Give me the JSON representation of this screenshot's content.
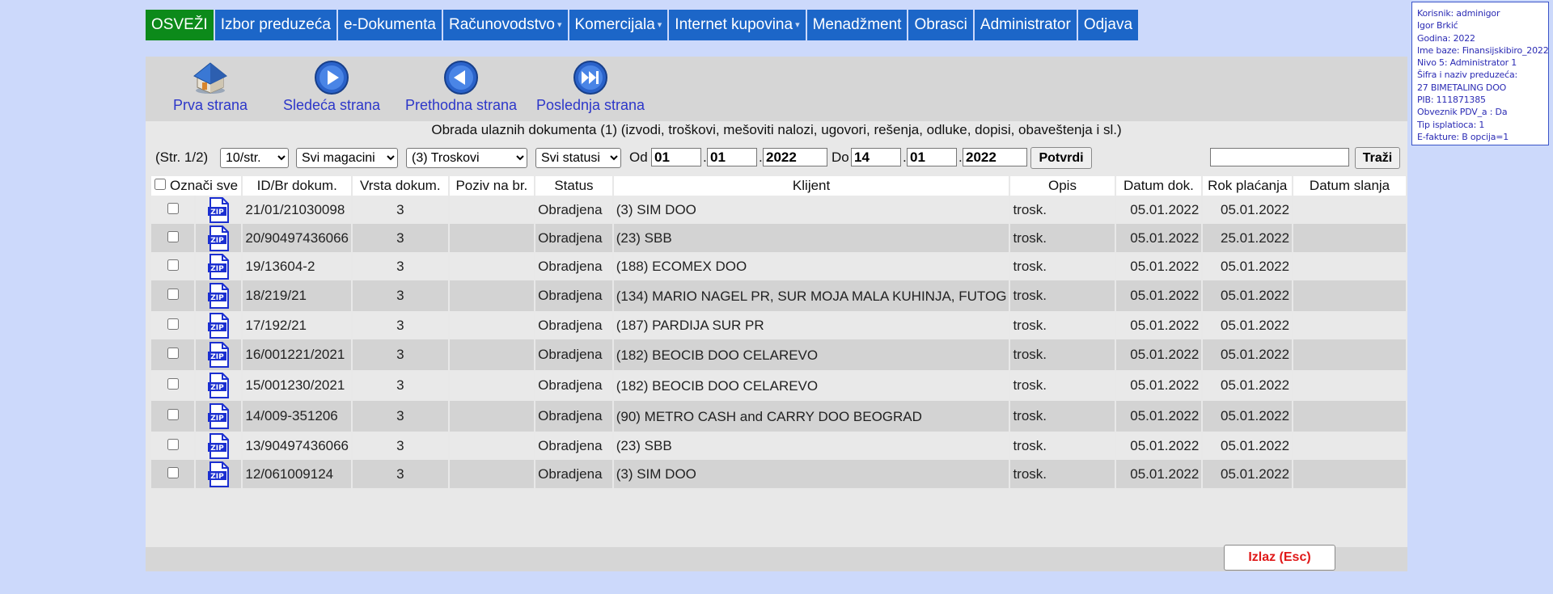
{
  "nav": {
    "items": [
      {
        "label": "OSVEŽI"
      },
      {
        "label": "Izbor preduzeća"
      },
      {
        "label": "e-Dokumenta"
      },
      {
        "label": "Računovodstvo"
      },
      {
        "label": "Komercijala"
      },
      {
        "label": "Internet kupovina"
      },
      {
        "label": "Menadžment"
      },
      {
        "label": "Obrasci"
      },
      {
        "label": "Administrator"
      },
      {
        "label": "Odjava"
      }
    ],
    "caret": "▾",
    "active_color": "#0c8a1a",
    "color": "#1c66c8"
  },
  "info": {
    "lines": [
      "Korisnik: adminigor",
      "Igor Brkić",
      "Godina: 2022",
      "Ime baze: Finansijskibiro_2022",
      "Nivo 5: Administrator 1",
      "Šifra i naziv preduzeća:",
      "27 BIMETALING DOO",
      "PIB: 111871385",
      "Obveznik PDV_a : Da",
      "Tip isplatioca: 1",
      "E-fakture: B opcija=1"
    ]
  },
  "toolbar": {
    "first": "Prva strana",
    "next": "Sledeća strana",
    "prev": "Prethodna strana",
    "last": "Poslednja strana"
  },
  "caption": "Obrada ulaznih dokumenta (1) (izvodi, troškovi, mešoviti nalozi, ugovori, rešenja, odluke, dopisi, obaveštenja i sl.)",
  "filters": {
    "page": "(Str. 1/2)",
    "per_page": "10/str.",
    "warehouse": "Svi magacini",
    "doc_type": "(3) Troskovi",
    "status": "Svi statusi",
    "from_label": "Od",
    "from_day": "01",
    "from_month": "01",
    "from_year": "2022",
    "to_label": "Do",
    "to_day": "14",
    "to_month": "01",
    "to_year": "2022",
    "dot": ".",
    "confirm": "Potvrdi",
    "search_value": "",
    "search_button": "Traži"
  },
  "table": {
    "columns": [
      "Označi sve",
      "ID/Br dokum.",
      "Vrsta dokum.",
      "Poziv na br.",
      "Status",
      "Klijent",
      "Opis",
      "Datum dok.",
      "Rok plaćanja",
      "Datum slanja"
    ],
    "zip_label": "ZIP",
    "rows": [
      {
        "id": "21/01/21030098",
        "type": "3",
        "ref": "",
        "status": "Obradjena",
        "client": "(3) SIM DOO",
        "desc": "trosk.",
        "date": "05.01.2022",
        "due": "05.01.2022",
        "sent": ""
      },
      {
        "id": "20/90497436066",
        "type": "3",
        "ref": "",
        "status": "Obradjena",
        "client": "(23) SBB",
        "desc": "trosk.",
        "date": "05.01.2022",
        "due": "25.01.2022",
        "sent": ""
      },
      {
        "id": "19/13604-2",
        "type": "3",
        "ref": "",
        "status": "Obradjena",
        "client": "(188) ECOMEX DOO",
        "desc": "trosk.",
        "date": "05.01.2022",
        "due": "05.01.2022",
        "sent": ""
      },
      {
        "id": "18/219/21",
        "type": "3",
        "ref": "",
        "status": "Obradjena",
        "client": "(134) MARIO NAGEL PR, SUR MOJA MALA KUHINJA, FUTOG",
        "desc": "trosk.",
        "date": "05.01.2022",
        "due": "05.01.2022",
        "sent": ""
      },
      {
        "id": "17/192/21",
        "type": "3",
        "ref": "",
        "status": "Obradjena",
        "client": "(187) PARDIJA SUR PR",
        "desc": "trosk.",
        "date": "05.01.2022",
        "due": "05.01.2022",
        "sent": ""
      },
      {
        "id": "16/001221/2021",
        "type": "3",
        "ref": "",
        "status": "Obradjena",
        "client": "(182) BEOCIB DOO CELAREVO",
        "desc": "trosk.",
        "date": "05.01.2022",
        "due": "05.01.2022",
        "sent": ""
      },
      {
        "id": "15/001230/2021",
        "type": "3",
        "ref": "",
        "status": "Obradjena",
        "client": "(182) BEOCIB DOO CELAREVO",
        "desc": "trosk.",
        "date": "05.01.2022",
        "due": "05.01.2022",
        "sent": ""
      },
      {
        "id": "14/009-351206",
        "type": "3",
        "ref": "",
        "status": "Obradjena",
        "client": "(90) METRO CASH and CARRY DOO BEOGRAD",
        "desc": "trosk.",
        "date": "05.01.2022",
        "due": "05.01.2022",
        "sent": ""
      },
      {
        "id": "13/90497436066",
        "type": "3",
        "ref": "",
        "status": "Obradjena",
        "client": "(23) SBB",
        "desc": "trosk.",
        "date": "05.01.2022",
        "due": "05.01.2022",
        "sent": ""
      },
      {
        "id": "12/061009124",
        "type": "3",
        "ref": "",
        "status": "Obradjena",
        "client": "(3) SIM DOO",
        "desc": "trosk.",
        "date": "05.01.2022",
        "due": "05.01.2022",
        "sent": ""
      }
    ]
  },
  "exit_button": "Izlaz (Esc)"
}
